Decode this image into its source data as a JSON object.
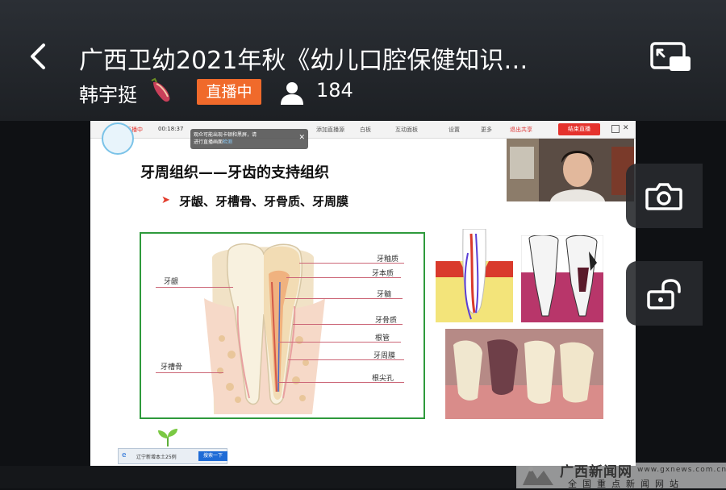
{
  "header": {
    "title": "广西卫幼2021年秋《幼儿口腔保健知识…",
    "host_name": "韩宇挺",
    "live_badge": "直播中",
    "viewer_count": "184"
  },
  "video": {
    "toolbar": {
      "live_label": "直播中",
      "elapsed": "00:18:37",
      "items": [
        "添加直播源",
        "白板",
        "互动面板",
        "设置",
        "更多"
      ],
      "exit_share": "退出共享",
      "end_live": "结束直播"
    },
    "notice": {
      "line1": "观众可能出现卡顿和黑屏，请",
      "line2_prefix": "进行直播画面",
      "line2_link": "检测"
    },
    "slide": {
      "title": "牙周组织——牙齿的支持组织",
      "bullet": "牙龈、牙槽骨、牙骨质、牙周膜",
      "left_labels": [
        "牙龈",
        "牙槽骨"
      ],
      "right_labels": [
        "牙釉质",
        "牙本质",
        "牙髓",
        "牙骨质",
        "根管",
        "牙周膜",
        "根尖孔"
      ]
    },
    "taskbar": {
      "news": "辽宁新增本土25例",
      "search_button": "搜索一下"
    }
  },
  "watermark": {
    "name": "广西新闻网",
    "url": "www.gxnews.com.cn",
    "slogan": "全国重点新闻网站"
  },
  "colors": {
    "live_badge": "#f06a2b",
    "diagram_border": "#2e9a3c",
    "bullet_arrow": "#e23b2b"
  },
  "icons": [
    "back-arrow-icon",
    "picture-in-picture-icon",
    "sweet-potato-icon",
    "person-icon",
    "camera-icon",
    "unlock-icon"
  ]
}
